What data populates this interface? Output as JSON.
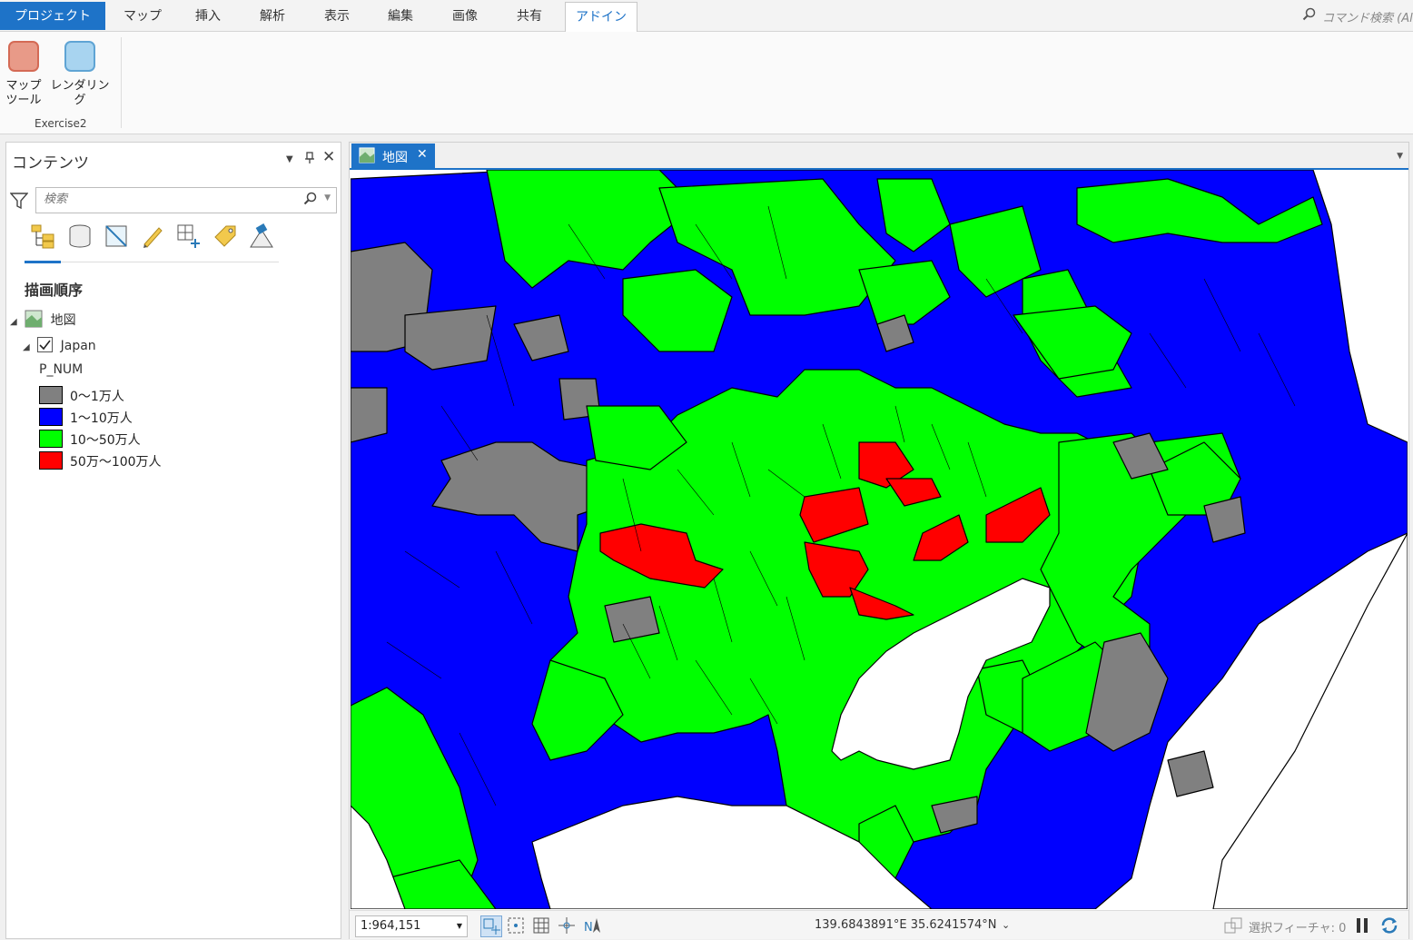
{
  "ribbon": {
    "tabs": [
      "プロジェクト",
      "マップ",
      "挿入",
      "解析",
      "表示",
      "編集",
      "画像",
      "共有",
      "アドイン"
    ],
    "active_tab": "アドイン",
    "command_search_placeholder": "コマンド検索 (Al",
    "buttons": [
      {
        "label_line1": "マップ",
        "label_line2": "ツール",
        "color": "#e89a88"
      },
      {
        "label_line1": "レンダリング",
        "label_line2": "",
        "color": "#a8d4f0"
      }
    ],
    "group_label": "Exercise2"
  },
  "contents": {
    "title": "コンテンツ",
    "search_placeholder": "検索",
    "section": "描画順序",
    "map_node": "地図",
    "layer_name": "Japan",
    "layer_checked": true,
    "field": "P_NUM",
    "legend": [
      {
        "label": "0〜1万人",
        "color": "#808080"
      },
      {
        "label": "1〜10万人",
        "color": "#0000ff"
      },
      {
        "label": "10〜50万人",
        "color": "#00ff00"
      },
      {
        "label": "50万〜100万人",
        "color": "#ff0000"
      }
    ]
  },
  "map": {
    "tab_label": "地図",
    "scale": "1:964,151",
    "coordinates": "139.6843891°E 35.6241574°N",
    "selected_features": "選択フィーチャ: 0"
  }
}
